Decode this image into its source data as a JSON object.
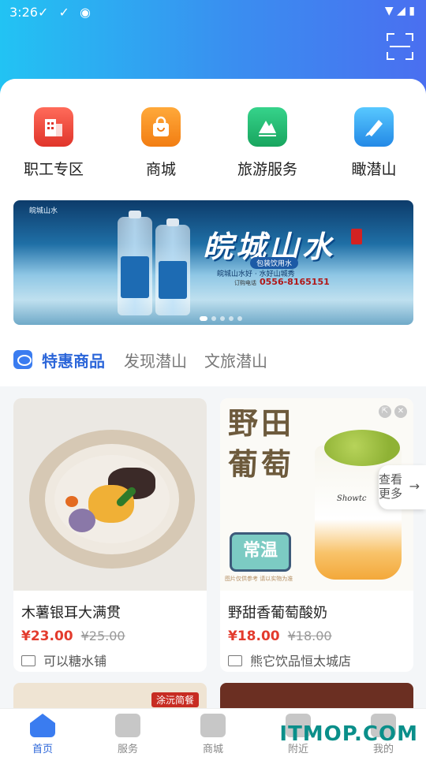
{
  "status": {
    "time": "3:26"
  },
  "quick_actions": [
    {
      "label": "职工专区",
      "icon": "building-icon",
      "color": "#e0342a"
    },
    {
      "label": "商城",
      "icon": "shopping-bag-icon",
      "color": "#f27d12"
    },
    {
      "label": "旅游服务",
      "icon": "mountain-icon",
      "color": "#18a55e"
    },
    {
      "label": "瞰潜山",
      "icon": "pen-icon",
      "color": "#2389e6"
    }
  ],
  "banner": {
    "header": "皖城山水",
    "brand": "皖城山水",
    "tag": "包装饮用水",
    "slogan": "皖城山水好 · 水好山城秀",
    "phone_label": "订购电话",
    "phone": "0556-8165151"
  },
  "tabs": [
    {
      "label": "特惠商品",
      "active": true
    },
    {
      "label": "发现潜山",
      "active": false
    },
    {
      "label": "文旅潜山",
      "active": false
    }
  ],
  "products": [
    {
      "name": "木薯银耳大满贯",
      "price": "¥23.00",
      "old_price": "¥25.00",
      "shop": "可以糖水铺"
    },
    {
      "name": "野甜香葡萄酸奶",
      "price": "¥18.00",
      "old_price": "¥18.00",
      "shop": "熊它饮品恒太城店",
      "image_title": "野田葡萄",
      "badge": "常温",
      "cup_brand": "Showtc",
      "disclaimer": "图片仅供参考 请以实物为准"
    }
  ],
  "peek": {
    "line1": "查看",
    "line2": "更多",
    "arrow": "→"
  },
  "row2": {
    "promo": "涂沅简餐"
  },
  "nav": [
    {
      "label": "首页",
      "active": true
    },
    {
      "label": "服务",
      "active": false
    },
    {
      "label": "商城",
      "active": false
    },
    {
      "label": "附近",
      "active": false
    },
    {
      "label": "我的",
      "active": false
    }
  ],
  "watermark": "ITMOP.COM",
  "colors": {
    "accent": "#2c66d9",
    "price": "#e33b2d"
  }
}
